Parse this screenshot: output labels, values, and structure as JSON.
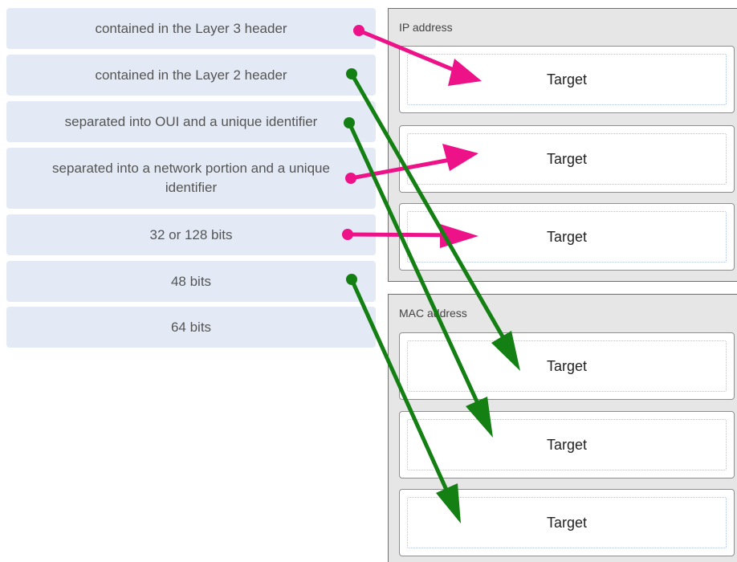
{
  "items": [
    {
      "label": "contained in the Layer 3 header"
    },
    {
      "label": "contained in the Layer 2 header"
    },
    {
      "label": "separated into OUI and a unique identifier"
    },
    {
      "label": "separated into a network portion and a unique identifier"
    },
    {
      "label": "32 or 128 bits"
    },
    {
      "label": "48 bits"
    },
    {
      "label": "64 bits"
    }
  ],
  "panels": [
    {
      "title": "IP address",
      "targets": [
        {
          "label": "Target"
        },
        {
          "label": "Target"
        },
        {
          "label": "Target"
        }
      ]
    },
    {
      "title": "MAC address",
      "targets": [
        {
          "label": "Target"
        },
        {
          "label": "Target"
        },
        {
          "label": "Target"
        }
      ]
    }
  ],
  "colors": {
    "pink_arrow": "#ee1289",
    "green_arrow": "#148014"
  }
}
